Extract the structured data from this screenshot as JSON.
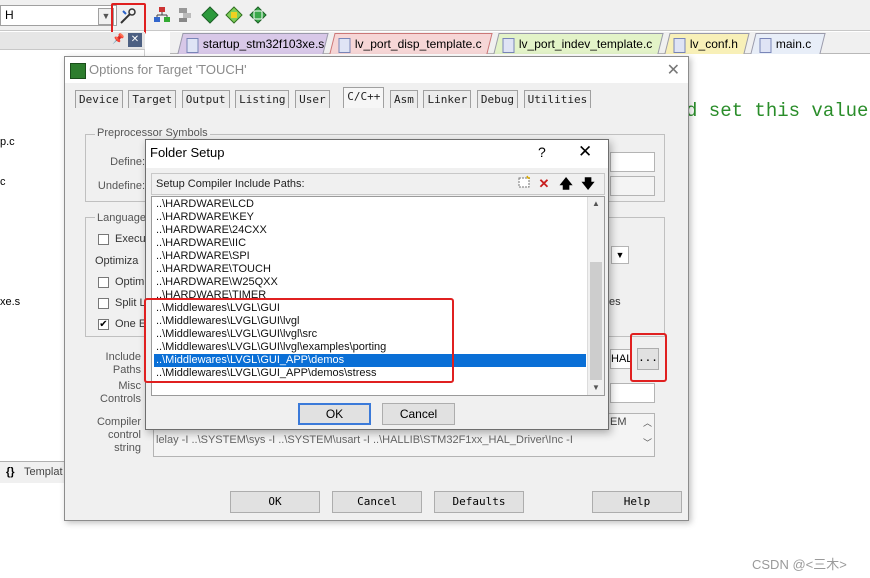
{
  "ide": {
    "target_combo": "H",
    "file_tabs": [
      {
        "label": "startup_stm32f103xe.s",
        "active": false
      },
      {
        "label": "lv_port_disp_template.c",
        "active": true
      },
      {
        "label": "lv_port_indev_template.c",
        "active": false
      },
      {
        "label": "lv_conf.h",
        "active": false
      },
      {
        "label": "main.c",
        "active": false
      }
    ],
    "left_panel_files": [
      "p.c",
      "c",
      "xe.s"
    ],
    "bottom_tab": "Templat",
    "bottom_tab_icon": "{}",
    "code_snippet": "d set this value"
  },
  "options_dialog": {
    "title": "Options for Target 'TOUCH'",
    "tabs": [
      "Device",
      "Target",
      "Output",
      "Listing",
      "User",
      "C/C++",
      "Asm",
      "Linker",
      "Debug",
      "Utilities"
    ],
    "active_tab": "C/C++",
    "preprocessor_group": "Preprocessor Symbols",
    "define_label": "Define:",
    "undefine_label": "Undefine:",
    "language_group": "Language",
    "execute_label": "Execu",
    "optimization_label": "Optimiza",
    "optimize_label": "Optimi",
    "split_label": "Split L",
    "one_elf_label": "One E",
    "es_label": "es",
    "include_paths_label": "Include Paths",
    "include_paths_value": "HAL",
    "browse_label": "...",
    "misc_controls_label": "Misc Controls",
    "compiler_control_label": "Compiler control string",
    "compiler_control_value": "lelay -I ..\\SYSTEM\\sys -I ..\\SYSTEM\\usart -I ..\\HALLIB\\STM32F1xx_HAL_Driver\\Inc -I",
    "compiler_control_tail": "EM",
    "ok": "OK",
    "cancel": "Cancel",
    "defaults": "Defaults",
    "help": "Help"
  },
  "folder_setup": {
    "title": "Folder Setup",
    "help_glyph": "?",
    "close_glyph": "✕",
    "list_header": "Setup Compiler Include Paths:",
    "paths": [
      "..\\HARDWARE\\LCD",
      "..\\HARDWARE\\KEY",
      "..\\HARDWARE\\24CXX",
      "..\\HARDWARE\\IIC",
      "..\\HARDWARE\\SPI",
      "..\\HARDWARE\\TOUCH",
      "..\\HARDWARE\\W25QXX",
      "..\\HARDWARE\\TIMER",
      "..\\Middlewares\\LVGL\\GUI",
      "..\\Middlewares\\LVGL\\GUI\\lvgl",
      "..\\Middlewares\\LVGL\\GUI\\lvgl\\src",
      "..\\Middlewares\\LVGL\\GUI\\lvgl\\examples\\porting",
      "..\\Middlewares\\LVGL\\GUI_APP\\demos",
      "..\\Middlewares\\LVGL\\GUI_APP\\demos\\stress"
    ],
    "selected_index": 12,
    "ok": "OK",
    "cancel": "Cancel"
  },
  "watermark": "CSDN @<三木>",
  "colors": {
    "highlight_red": "#e02020",
    "selection_blue": "#0a6fd6",
    "code_green": "#2a8d2a"
  }
}
